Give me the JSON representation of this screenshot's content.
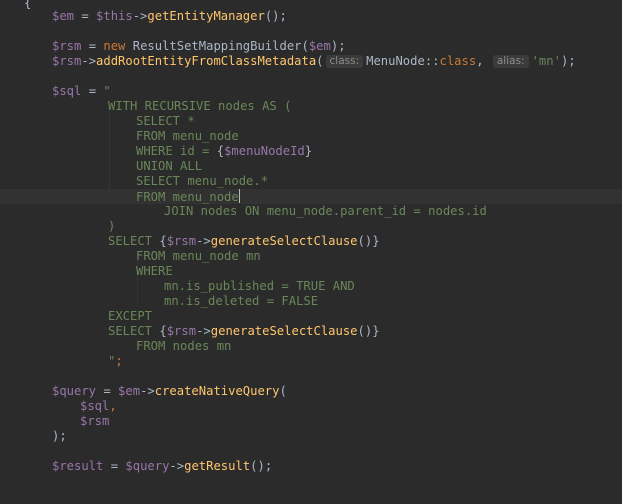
{
  "editor": {
    "lines": {
      "l00": {
        "t0": "{"
      },
      "l01": {
        "t0": "$em",
        "t1": " = ",
        "t2": "$this",
        "t3": "->",
        "t4": "getEntityManager",
        "t5": "();"
      },
      "l03": {
        "t0": "$rsm",
        "t1": " = ",
        "t2": "new ",
        "t3": "ResultSetMappingBuilder(",
        "t4": "$em",
        "t5": ");"
      },
      "l04": {
        "t0": "$rsm",
        "t1": "->",
        "t2": "addRootEntityFromClassMetadata",
        "t3": "(",
        "h1": "class:",
        "t4": "MenuNode::",
        "t5": "class",
        "t6": ", ",
        "h2": "alias:",
        "t7": "'mn'",
        "t8": ");"
      },
      "l06": {
        "t0": "$sql",
        "t1": " = ",
        "t2": "\""
      },
      "l07": {
        "t0": "WITH RECURSIVE nodes AS ("
      },
      "l08": {
        "t0": "SELECT *"
      },
      "l09": {
        "t0": "FROM menu_node"
      },
      "l10": {
        "t0": "WHERE id = ",
        "t1": "{",
        "t2": "$menuNodeId",
        "t3": "}"
      },
      "l11": {
        "t0": "UNION ALL"
      },
      "l12": {
        "t0": "SELECT menu_node.*"
      },
      "l13": {
        "t0": "FROM menu_node"
      },
      "l14": {
        "t0": "JOIN nodes ON menu_node.parent_id = nodes.id"
      },
      "l15": {
        "t0": ")"
      },
      "l16": {
        "t0": "SELECT ",
        "t1": "{",
        "t2": "$rsm",
        "t3": "->",
        "t4": "generateSelectClause",
        "t5": "()",
        "t6": "}"
      },
      "l17": {
        "t0": "FROM menu_node mn"
      },
      "l18": {
        "t0": "WHERE"
      },
      "l19": {
        "t0": "mn.is_published = TRUE AND"
      },
      "l20": {
        "t0": "mn.is_deleted = FALSE"
      },
      "l21": {
        "t0": "EXCEPT"
      },
      "l22": {
        "t0": "SELECT ",
        "t1": "{",
        "t2": "$rsm",
        "t3": "->",
        "t4": "generateSelectClause",
        "t5": "()",
        "t6": "}"
      },
      "l23": {
        "t0": "FROM nodes mn"
      },
      "l24": {
        "t0": "\"",
        "t1": ";"
      },
      "l26": {
        "t0": "$query",
        "t1": " = ",
        "t2": "$em",
        "t3": "->",
        "t4": "createNativeQuery",
        "t5": "("
      },
      "l27": {
        "t0": "$sql",
        "t1": ","
      },
      "l28": {
        "t0": "$rsm"
      },
      "l29": {
        "t0": ");"
      },
      "l31": {
        "t0": "$result",
        "t1": " = ",
        "t2": "$query",
        "t3": "->",
        "t4": "getResult",
        "t5": "();"
      }
    },
    "colors": {
      "background": "#2b2b2b",
      "variable": "#9876aa",
      "keyword": "#cc7832",
      "function": "#ffc66d",
      "string": "#6a8759",
      "plain": "#a9b7c6"
    }
  }
}
